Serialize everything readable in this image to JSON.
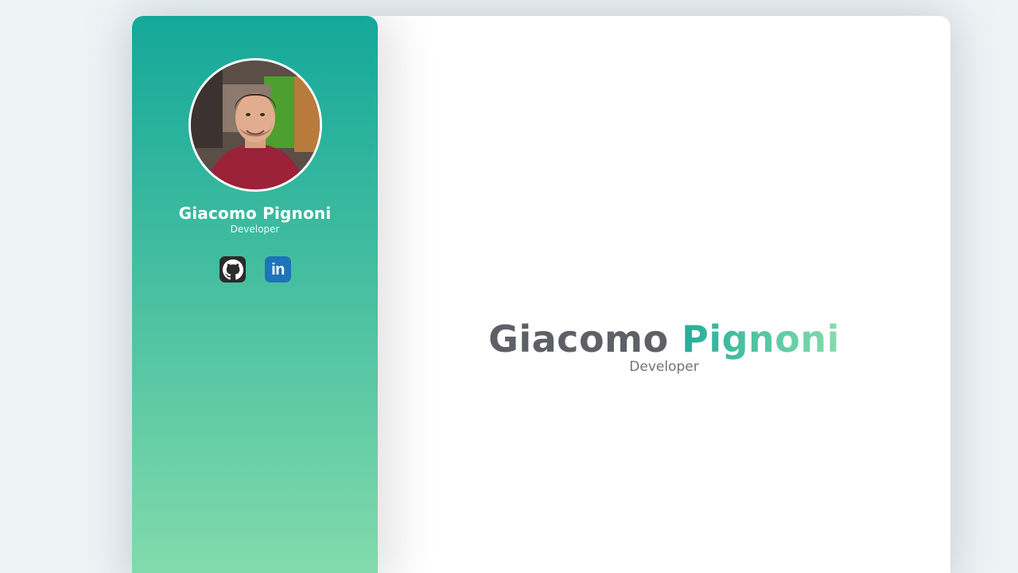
{
  "profile": {
    "first_name": "Giacomo",
    "last_name": "Pignoni",
    "full_name": "Giacomo Pignoni",
    "role": "Developer"
  },
  "social": {
    "linkedin_label": "in",
    "icons": [
      "github-icon",
      "linkedin-icon"
    ]
  },
  "colors": {
    "sidebar_gradient_top": "#14a89a",
    "sidebar_gradient_bottom": "#85dcac",
    "accent": "#45bea0",
    "name_gray": "#5e6066",
    "github_bg": "#2b2b2b",
    "linkedin_bg": "#1d74b8"
  }
}
